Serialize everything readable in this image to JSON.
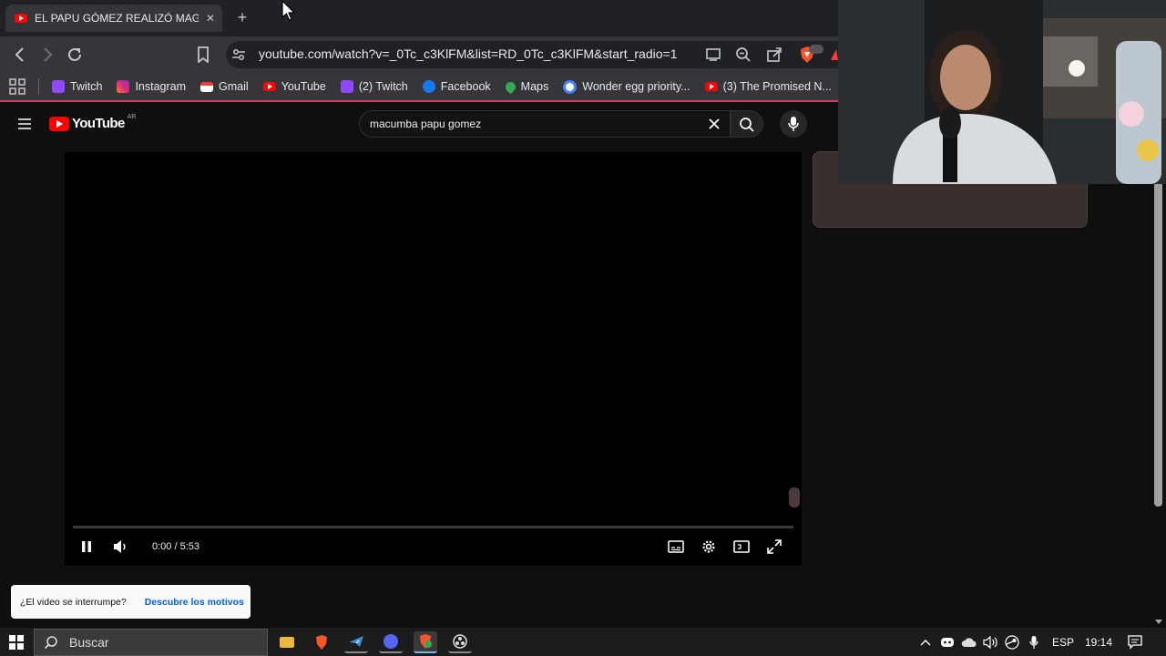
{
  "browser": {
    "tab": {
      "title": "EL PAPU GÓMEZ REALIZÓ MAGIA",
      "close": "✕"
    },
    "new_tab": "+",
    "address": {
      "url": "youtube.com/watch?v=_0Tc_c3KlFM&list=RD_0Tc_c3KlFM&start_radio=1"
    },
    "bookmarks": [
      {
        "label": "Twitch",
        "color": "#9146ff"
      },
      {
        "label": "Instagram",
        "color": "#d62976"
      },
      {
        "label": "Gmail",
        "color": "#ea4335"
      },
      {
        "label": "YouTube",
        "color": "#ff0000"
      },
      {
        "label": "(2) Twitch",
        "color": "#9146ff"
      },
      {
        "label": "Facebook",
        "color": "#1877f2"
      },
      {
        "label": "Maps",
        "color": "#34a853"
      },
      {
        "label": "Wonder egg priority...",
        "color": "#ffffff"
      },
      {
        "label": "(3) The Promised N...",
        "color": "#ff0000"
      }
    ]
  },
  "youtube": {
    "logo_text": "YouTube",
    "region": "AR",
    "search": {
      "query": "macumba papu gomez"
    },
    "player": {
      "time": "0:00 / 5:53",
      "progress": 0.0
    },
    "notice": {
      "question": "¿El video se interrumpe?",
      "link": "Descubre los motivos"
    }
  },
  "taskbar": {
    "search_placeholder": "Buscar",
    "language": "ESP",
    "clock": "19:14"
  },
  "colors": {
    "accent_pink": "#d63a5e",
    "youtube_red": "#ff0000",
    "link_blue": "#065fd4"
  }
}
